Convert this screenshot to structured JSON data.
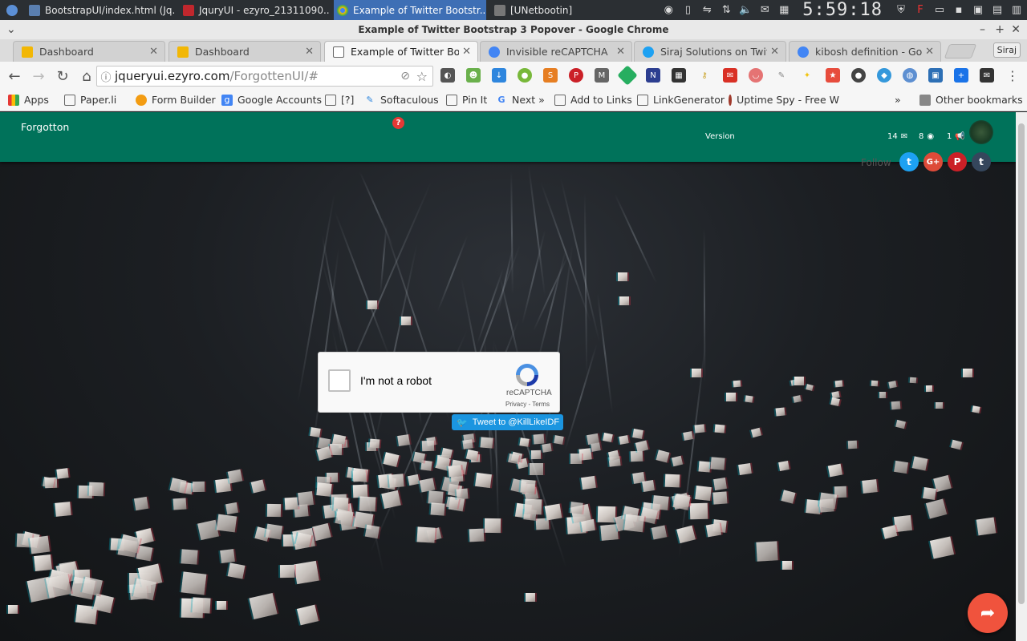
{
  "taskbar": {
    "tasks": [
      {
        "label": "BootstrapUI/index.html (Jq...",
        "color": "#5a7fb0"
      },
      {
        "label": "JquryUI - ezyro_21311090...",
        "color": "#c0272d"
      },
      {
        "label": "Example of Twitter Bootstr...",
        "color": "#4caf50"
      },
      {
        "label": "[UNetbootin]",
        "color": "#777777"
      }
    ],
    "clock": "5:59:18"
  },
  "window": {
    "title": "Example of Twitter Bootstrap 3 Popover - Google Chrome",
    "tabs": [
      {
        "label": "Dashboard",
        "icon": "dashboard-icon",
        "color": "#f2b705"
      },
      {
        "label": "Dashboard",
        "icon": "dashboard-icon",
        "color": "#f2b705"
      },
      {
        "label": "Example of Twitter Boot",
        "icon": "page-icon",
        "color": "#555555"
      },
      {
        "label": "Invisible reCAPTCHA",
        "icon": "google-icon",
        "color": "#4285f4"
      },
      {
        "label": "Siraj Solutions on Twitte",
        "icon": "twitter-icon",
        "color": "#1da1f2"
      },
      {
        "label": "kibosh definition - Goog",
        "icon": "google-icon",
        "color": "#4285f4"
      }
    ],
    "profile": "Siraj"
  },
  "toolbar": {
    "url_host": "jqueryui.ezyro.com",
    "url_path": "/ForgottenUI/#"
  },
  "bookmarks": {
    "items": [
      {
        "label": "Apps",
        "icon": "apps-grid-icon"
      },
      {
        "label": "Paper.li",
        "icon": "page-icon"
      },
      {
        "label": "Form Builder",
        "icon": "form-builder-icon"
      },
      {
        "label": "Google Accounts",
        "icon": "google-icon"
      },
      {
        "label": "[?]",
        "icon": "page-icon"
      },
      {
        "label": "Softaculous",
        "icon": "softaculous-icon"
      },
      {
        "label": "Pin It",
        "icon": "page-icon"
      },
      {
        "label": "Next »",
        "icon": "google-icon"
      },
      {
        "label": "Add to Links",
        "icon": "page-icon"
      },
      {
        "label": "LinkGenerator",
        "icon": "page-icon"
      },
      {
        "label": "Uptime Spy - Free W",
        "icon": "uptime-spy-icon"
      }
    ],
    "overflow": "»",
    "other": "Other bookmarks"
  },
  "page": {
    "brand": "Forgotton",
    "version_label": "Version",
    "stats": {
      "messages": "14",
      "views": "8",
      "announcements": "1"
    },
    "follow_label": "Follow",
    "social": [
      {
        "name": "twitter",
        "glyph": "t",
        "color": "#1da1f2"
      },
      {
        "name": "google-plus",
        "glyph": "G+",
        "color": "#dd4b39"
      },
      {
        "name": "pinterest",
        "glyph": "P",
        "color": "#cb2027"
      },
      {
        "name": "tumblr",
        "glyph": "t",
        "color": "#35465c"
      }
    ],
    "recaptcha": {
      "label": "I'm not a robot",
      "brand": "reCAPTCHA",
      "terms": "Privacy - Terms"
    },
    "tweet_button": "Tweet to @KillLikeIDF"
  }
}
